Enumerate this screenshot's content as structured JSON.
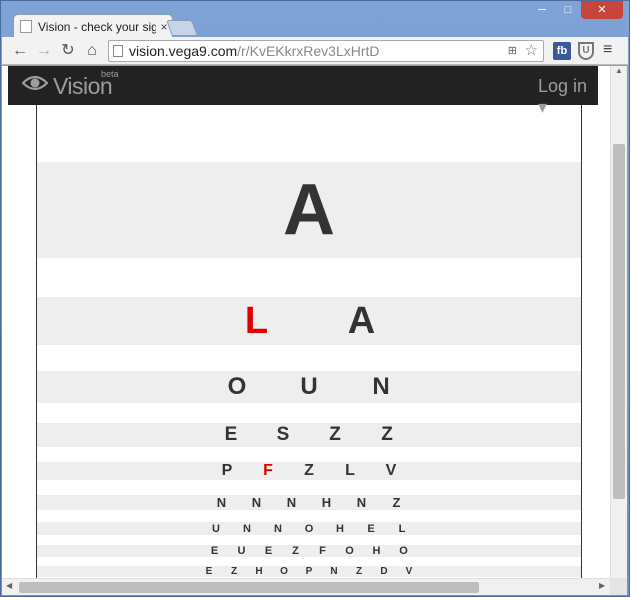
{
  "browser": {
    "tab_title": "Vision - check your sight",
    "tab_close": "×",
    "url_host": "vision.vega9.com",
    "url_path": "/r/KvEKkrxRev3LxHrtD",
    "back": "←",
    "forward": "→",
    "reload": "↻",
    "home": "⌂",
    "star": "☆",
    "fb_ext": "fb",
    "menu": "≡",
    "win_min": "─",
    "win_max": "□",
    "win_close": "✕"
  },
  "site": {
    "brand": "Vision",
    "beta": "beta",
    "login": "Log in ▾",
    "accent": "#e00000",
    "navbar_bg": "#222222"
  },
  "eye_chart": {
    "rows": [
      {
        "letters": [
          "A"
        ],
        "red": []
      },
      {
        "letters": [
          "L",
          "A"
        ],
        "red": [
          0
        ]
      },
      {
        "letters": [
          "O",
          "U",
          "N"
        ],
        "red": []
      },
      {
        "letters": [
          "E",
          "S",
          "Z",
          "Z"
        ],
        "red": []
      },
      {
        "letters": [
          "P",
          "F",
          "Z",
          "L",
          "V"
        ],
        "red": [
          1
        ]
      },
      {
        "letters": [
          "N",
          "N",
          "N",
          "H",
          "N",
          "Z"
        ],
        "red": []
      },
      {
        "letters": [
          "U",
          "N",
          "N",
          "O",
          "H",
          "E",
          "L"
        ],
        "red": []
      },
      {
        "letters": [
          "E",
          "U",
          "E",
          "Z",
          "F",
          "O",
          "H",
          "O"
        ],
        "red": []
      },
      {
        "letters": [
          "E",
          "Z",
          "H",
          "O",
          "P",
          "N",
          "Z",
          "D",
          "V"
        ],
        "red": []
      }
    ]
  }
}
